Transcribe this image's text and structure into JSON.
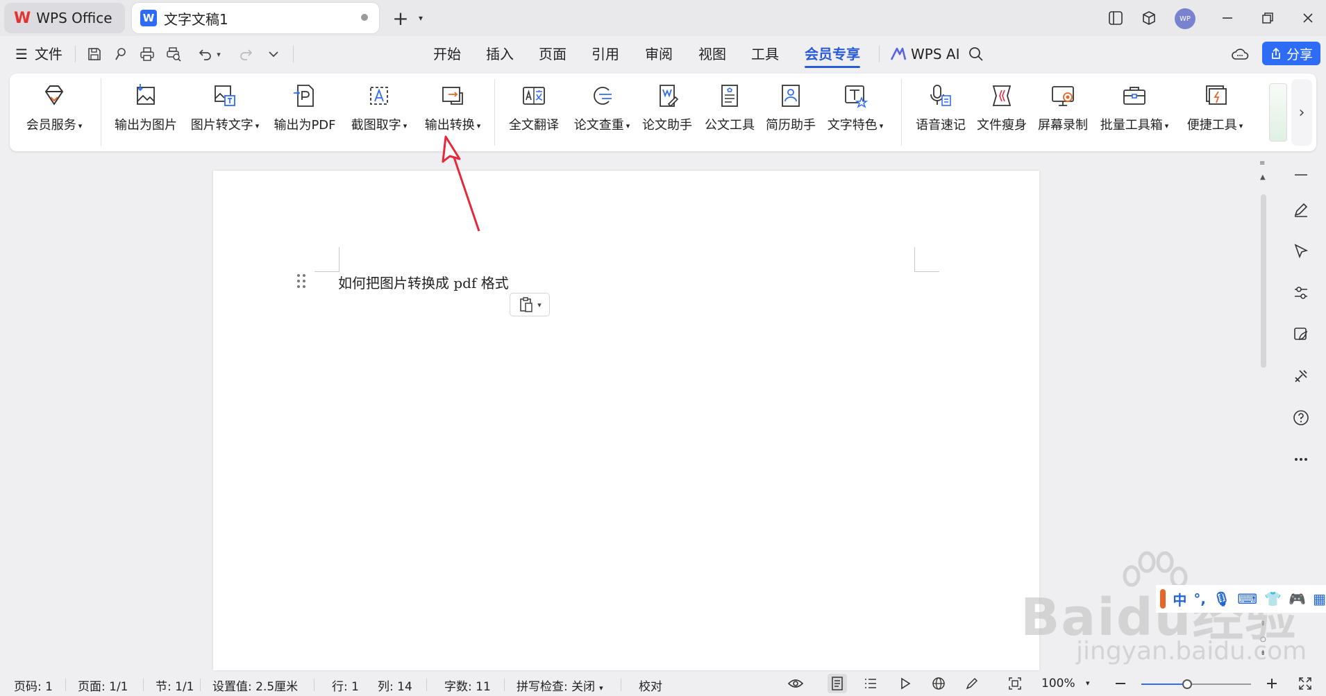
{
  "titlebar": {
    "app_tab": "WPS Office",
    "doc_tab": "文字文稿1",
    "avatar_initials": "WP",
    "new_tab_icon": "plus-icon"
  },
  "menubar": {
    "file_label": "文件",
    "tabs": [
      "开始",
      "插入",
      "页面",
      "引用",
      "审阅",
      "视图",
      "工具",
      "会员专享"
    ],
    "active_tab": "会员专享",
    "ai_label": "WPS AI",
    "share_label": "分享"
  },
  "ribbon": {
    "items": [
      {
        "label": "会员服务",
        "icon": "diamond-icon",
        "dropdown": true
      },
      {
        "label": "输出为图片",
        "icon": "image-export-icon",
        "dropdown": false
      },
      {
        "label": "图片转文字",
        "icon": "image-to-text-icon",
        "dropdown": true
      },
      {
        "label": "输出为PDF",
        "icon": "pdf-export-icon",
        "dropdown": false
      },
      {
        "label": "截图取字",
        "icon": "screenshot-text-icon",
        "dropdown": true
      },
      {
        "label": "输出转换",
        "icon": "convert-icon",
        "dropdown": true
      },
      {
        "label": "全文翻译",
        "icon": "translate-icon",
        "dropdown": false
      },
      {
        "label": "论文查重",
        "icon": "plagiarism-check-icon",
        "dropdown": true
      },
      {
        "label": "论文助手",
        "icon": "paper-assistant-icon",
        "dropdown": false
      },
      {
        "label": "公文工具",
        "icon": "official-doc-icon",
        "dropdown": false
      },
      {
        "label": "简历助手",
        "icon": "resume-icon",
        "dropdown": false
      },
      {
        "label": "文字特色",
        "icon": "text-feature-icon",
        "dropdown": true
      },
      {
        "label": "语音速记",
        "icon": "voice-note-icon",
        "dropdown": false
      },
      {
        "label": "文件瘦身",
        "icon": "file-slim-icon",
        "dropdown": false
      },
      {
        "label": "屏幕录制",
        "icon": "screen-record-icon",
        "dropdown": false
      },
      {
        "label": "批量工具箱",
        "icon": "toolbox-icon",
        "dropdown": true
      },
      {
        "label": "便捷工具",
        "icon": "quick-tools-icon",
        "dropdown": true
      }
    ]
  },
  "document": {
    "text": "如何把图片转换成 pdf 格式"
  },
  "statusbar": {
    "page_code": "页码: 1",
    "page": "页面: 1/1",
    "section": "节: 1/1",
    "setting": "设置值: 2.5厘米",
    "row": "行: 1",
    "col": "列: 14",
    "word_count": "字数: 11",
    "spell_check": "拼写检查: 关闭",
    "proofread": "校对",
    "zoom": "100%",
    "zoom_fraction": 0.42
  },
  "watermark": {
    "logo_text": "Baidu经验",
    "url_text": "jingyan.baidu.com"
  },
  "ime": {
    "mode": "中"
  },
  "colors": {
    "accent": "#2a5bd7",
    "share": "#2f6cf6",
    "arrow": "#e8283a",
    "logo": "#e83030"
  }
}
